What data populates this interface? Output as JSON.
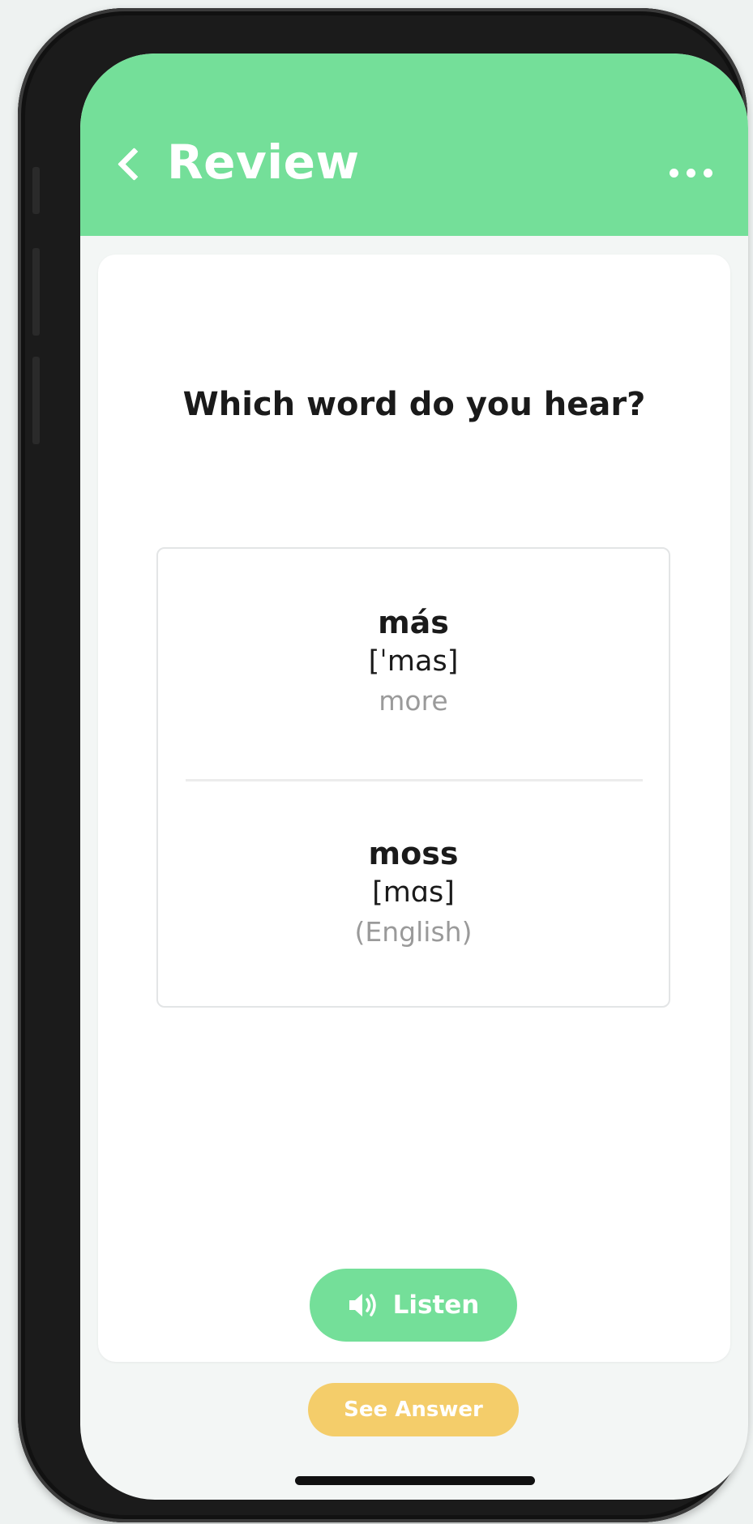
{
  "header": {
    "title": "Review",
    "back_icon": "chevron-left-icon",
    "more_icon": "more-dots-icon",
    "color": "#74df99"
  },
  "question": "Which word do you hear?",
  "options": [
    {
      "word": "más",
      "ipa": "[ˈmas]",
      "gloss": "more"
    },
    {
      "word": "moss",
      "ipa": "[mɑs]",
      "gloss": "(English)"
    }
  ],
  "listen_button": {
    "label": "Listen",
    "icon": "speaker-icon",
    "color": "#74df99"
  },
  "answer_button": {
    "label": "See Answer",
    "color": "#f4cd6a"
  }
}
